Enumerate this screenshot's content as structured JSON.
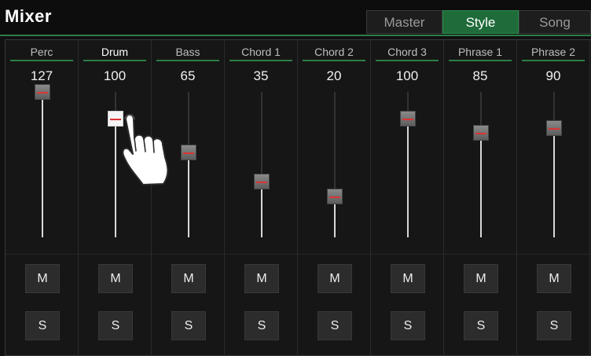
{
  "title": "Mixer",
  "tabs": [
    {
      "label": "Master",
      "active": false
    },
    {
      "label": "Style",
      "active": true
    },
    {
      "label": "Song",
      "active": false
    }
  ],
  "channels": [
    {
      "name": "Perc",
      "value": "127",
      "level": 127,
      "mute": "M",
      "solo": "S"
    },
    {
      "name": "Drum",
      "value": "100",
      "level": 100,
      "mute": "M",
      "solo": "S",
      "selected": true
    },
    {
      "name": "Bass",
      "value": "65",
      "level": 65,
      "mute": "M",
      "solo": "S"
    },
    {
      "name": "Chord 1",
      "value": "35",
      "level": 35,
      "mute": "M",
      "solo": "S"
    },
    {
      "name": "Chord 2",
      "value": "20",
      "level": 20,
      "mute": "M",
      "solo": "S"
    },
    {
      "name": "Chord 3",
      "value": "100",
      "level": 100,
      "mute": "M",
      "solo": "S"
    },
    {
      "name": "Phrase 1",
      "value": "85",
      "level": 85,
      "mute": "M",
      "solo": "S"
    },
    {
      "name": "Phrase 2",
      "value": "90",
      "level": 90,
      "mute": "M",
      "solo": "S"
    }
  ],
  "level_max": 127,
  "colors": {
    "accent": "#2e7d46",
    "tab_active": "#1f6b3a",
    "knob_marker": "#dd3333"
  },
  "icons": {
    "pointer": "hand-pointer-icon"
  }
}
